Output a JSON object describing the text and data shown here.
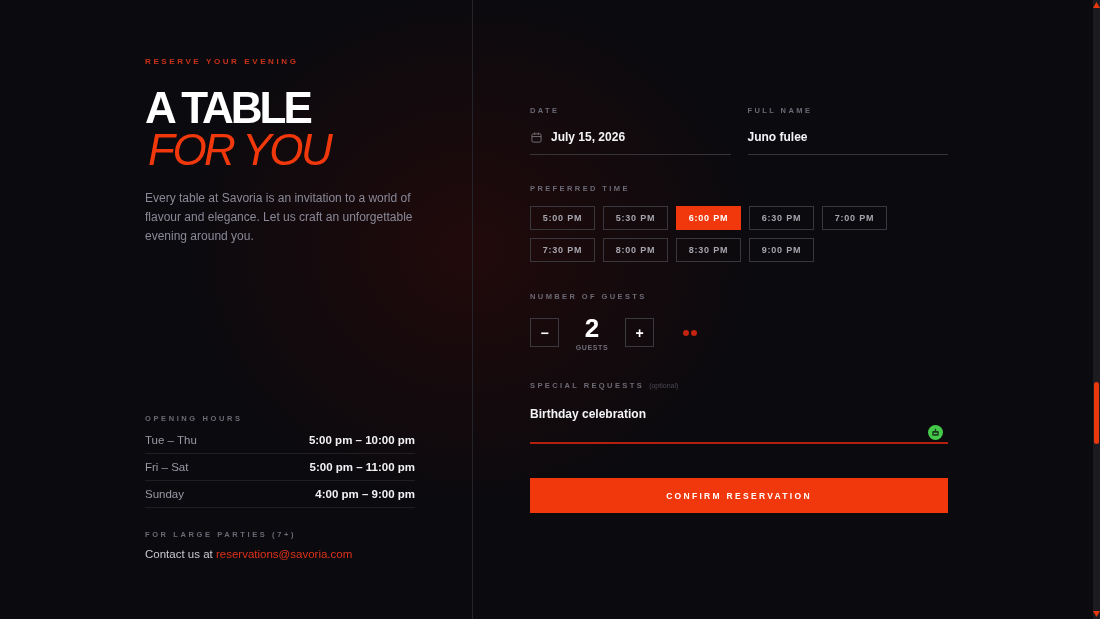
{
  "intro": {
    "eyebrow": "RESERVE YOUR EVENING",
    "title": "A TABLE",
    "title_accent": "FOR YOU",
    "description": "Every table at Savoria is an invitation to a world of flavour and elegance. Let us craft an unforgettable evening around you."
  },
  "opening_hours": {
    "heading": "OPENING HOURS",
    "rows": [
      {
        "days": "Tue – Thu",
        "hours": "5:00 pm – 10:00 pm"
      },
      {
        "days": "Fri – Sat",
        "hours": "5:00 pm – 11:00 pm"
      },
      {
        "days": "Sunday",
        "hours": "4:00 pm – 9:00 pm"
      }
    ]
  },
  "large_parties": {
    "heading": "FOR LARGE PARTIES (7+)",
    "text": "Contact us at",
    "email": "reservations@savoria.com"
  },
  "form": {
    "date": {
      "label": "DATE",
      "value": "July 15, 2026"
    },
    "full_name": {
      "label": "FULL NAME",
      "value": "Juno fulee"
    },
    "preferred_time": {
      "label": "PREFERRED TIME",
      "options": [
        {
          "label": "5:00 PM",
          "selected": false
        },
        {
          "label": "5:30 PM",
          "selected": false
        },
        {
          "label": "6:00 PM",
          "selected": true
        },
        {
          "label": "6:30 PM",
          "selected": false
        },
        {
          "label": "7:00 PM",
          "selected": false
        },
        {
          "label": "7:30 PM",
          "selected": false
        },
        {
          "label": "8:00 PM",
          "selected": false
        },
        {
          "label": "8:30 PM",
          "selected": false
        },
        {
          "label": "9:00 PM",
          "selected": false
        }
      ]
    },
    "guests": {
      "label": "NUMBER OF GUESTS",
      "decrement": "−",
      "count": "2",
      "unit": "GUESTS",
      "increment": "+"
    },
    "special_requests": {
      "label": "SPECIAL REQUESTS",
      "note": "(optional)",
      "value": "Birthday celebration",
      "focused": true
    },
    "submit": "CONFIRM RESERVATION"
  }
}
